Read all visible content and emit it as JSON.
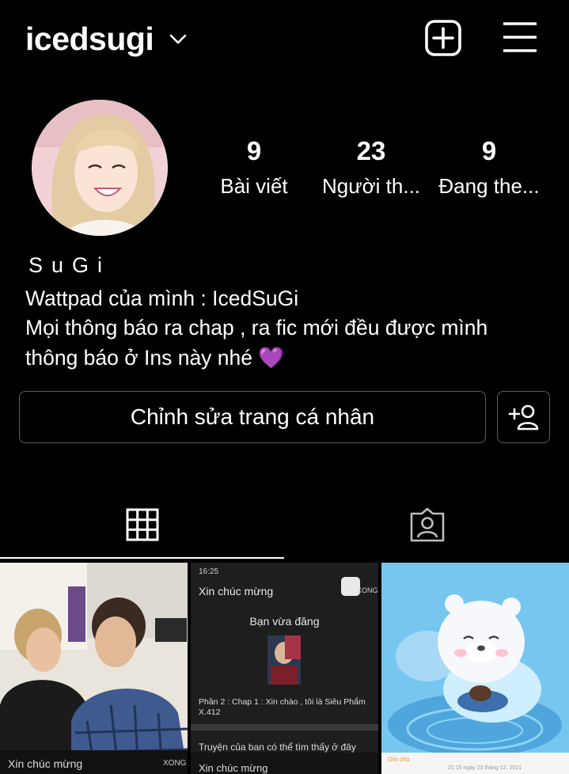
{
  "header": {
    "username": "icedsugi"
  },
  "stats": [
    {
      "value": "9",
      "label": "Bài viết"
    },
    {
      "value": "23",
      "label": "Người th..."
    },
    {
      "value": "9",
      "label": "Đang the..."
    }
  ],
  "bio": {
    "name": "SuGi",
    "line1": "Wattpad của mình : IcedSuGi",
    "line2": "Mọi thông báo ra chap , ra fic mới đều được mình",
    "line3": "thông báo ở Ins này nhé 💜"
  },
  "buttons": {
    "edit_profile": "Chỉnh sửa trang cá nhân"
  },
  "posts": {
    "tile1": {
      "caption": "Xin chúc mừng",
      "badge": "XONG"
    },
    "tile2": {
      "status_time": "16:25",
      "title": "Xin chúc mừng",
      "subtitle": "Bạn vừa đăng",
      "badge": "XONG",
      "story": "Phần 2 : Chap 1 : Xin chào , tôi là Siêu Phẩm X.412",
      "footer": "Truyện của ban có thể tìm thấy ở đây",
      "caption": "Xin chúc mừng"
    },
    "tile3": {
      "back_label": "Ghi chú",
      "date": "21:15 ngày 23 tháng 12, 2021"
    }
  }
}
